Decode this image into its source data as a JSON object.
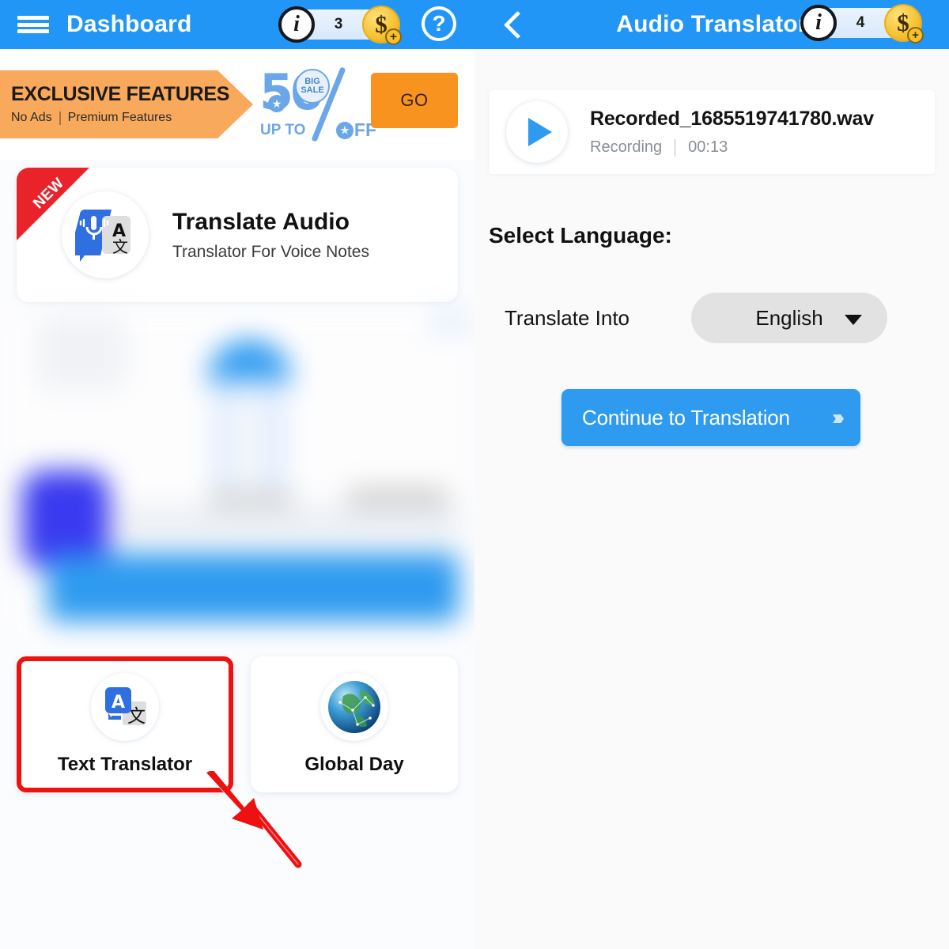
{
  "left_panel": {
    "appbar": {
      "menu_icon": "hamburger-menu-icon",
      "title": "Dashboard",
      "info_icon": "i",
      "credit_count": "3",
      "coin_icon": "$",
      "plus_badge": "+",
      "help_icon": "?"
    },
    "promo": {
      "title": "EXCLUSIVE FEATURES",
      "sub_left": "No Ads",
      "sub_right": "Premium Features",
      "sale_number": "50",
      "sale_badge_line1": "BIG",
      "sale_badge_line2": "SALE",
      "sale_upto": "UP TO",
      "sale_off": "FF",
      "go_label": "GO"
    },
    "feature_card": {
      "ribbon": "NEW",
      "icon": "audio-translate-icon",
      "title": "Translate Audio",
      "subtitle": "Translator For Voice Notes"
    },
    "ad_region": {
      "name": "blurred-advertisement",
      "text": ""
    },
    "tiles": [
      {
        "label": "Text Translator",
        "icon": "text-translator-icon",
        "highlighted": true
      },
      {
        "label": "Global Day",
        "icon": "globe-icon",
        "highlighted": false
      }
    ],
    "annotation": {
      "name": "red-pointer-arrow",
      "color": "#ee1111"
    }
  },
  "right_panel": {
    "appbar": {
      "back_icon": "back-chevron-icon",
      "title": "Audio Translator",
      "info_icon": "i",
      "credit_count": "4",
      "coin_icon": "$",
      "plus_badge": "+"
    },
    "audio": {
      "play_icon": "play-icon",
      "filename": "Recorded_1685519741780.wav",
      "status": "Recording",
      "duration": "00:13"
    },
    "language": {
      "heading": "Select Language:",
      "field_label": "Translate Into",
      "selected_value": "English",
      "caret_icon": "chevron-down-icon"
    },
    "continue": {
      "label": "Continue to Translation",
      "chevrons": "»›"
    }
  },
  "colors": {
    "appbar_blue": "#2196f7",
    "accent_blue": "#2e9bf0",
    "promo_orange": "#f8a95c",
    "go_orange": "#f7931e",
    "ribbon_red": "#e8232a",
    "highlight_red": "#ee1111"
  }
}
